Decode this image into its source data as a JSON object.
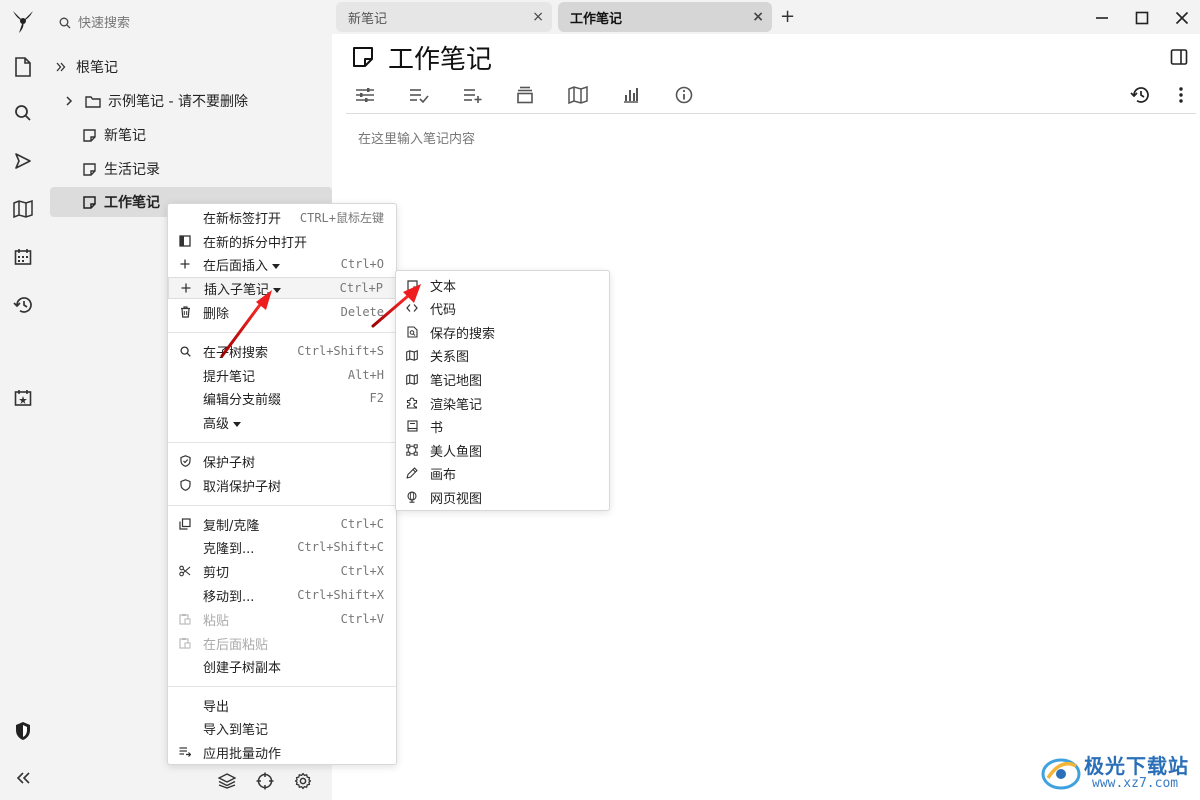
{
  "launcher": {
    "items": [
      "app-logo",
      "new-note",
      "search",
      "jump-to",
      "note-map",
      "calendar",
      "recent-changes",
      "day-note",
      "protected-session",
      "collapse"
    ]
  },
  "search": {
    "placeholder": "快速搜索"
  },
  "tree": {
    "root": "根笔记",
    "items": [
      {
        "label": "示例笔记 - 请不要删除",
        "type": "folder"
      },
      {
        "label": "新笔记",
        "type": "note"
      },
      {
        "label": "生活记录",
        "type": "note"
      },
      {
        "label": "工作笔记",
        "type": "note",
        "active": true
      }
    ]
  },
  "tabs": [
    {
      "label": "新笔记",
      "active": false
    },
    {
      "label": "工作笔记",
      "active": true
    }
  ],
  "tab_close": "×",
  "new_tab": "+",
  "note": {
    "title": "工作笔记",
    "placeholder": "在这里输入笔记内容"
  },
  "context_menu": {
    "items": [
      {
        "label": "在新标签打开",
        "key": "CTRL+鼠标左键",
        "icon": ""
      },
      {
        "label": "在新的拆分中打开",
        "key": "",
        "icon": "split-icon"
      },
      {
        "label": "在后面插入",
        "key": "Ctrl+O",
        "icon": "plus-icon",
        "caret": true
      },
      {
        "label": "插入子笔记",
        "key": "Ctrl+P",
        "icon": "plus-icon",
        "caret": true,
        "highlight": true
      },
      {
        "label": "删除",
        "key": "Delete",
        "icon": "trash-icon"
      },
      {
        "label": "在子树搜索",
        "key": "Ctrl+Shift+S",
        "icon": "search-icon"
      },
      {
        "label": "提升笔记",
        "key": "Alt+H",
        "icon": ""
      },
      {
        "label": "编辑分支前缀",
        "key": "F2",
        "icon": ""
      },
      {
        "label": "高级",
        "key": "",
        "icon": "",
        "caret": true
      },
      {
        "label": "保护子树",
        "key": "",
        "icon": "shield-check-icon"
      },
      {
        "label": "取消保护子树",
        "key": "",
        "icon": "shield-icon"
      },
      {
        "label": "复制/克隆",
        "key": "Ctrl+C",
        "icon": "copy-icon"
      },
      {
        "label": "克隆到...",
        "key": "Ctrl+Shift+C",
        "icon": ""
      },
      {
        "label": "剪切",
        "key": "Ctrl+X",
        "icon": "scissors-icon"
      },
      {
        "label": "移动到...",
        "key": "Ctrl+Shift+X",
        "icon": ""
      },
      {
        "label": "粘贴",
        "key": "Ctrl+V",
        "icon": "paste-icon",
        "disabled": true
      },
      {
        "label": "在后面粘贴",
        "key": "",
        "icon": "paste-icon",
        "disabled": true
      },
      {
        "label": "创建子树副本",
        "key": "",
        "icon": ""
      },
      {
        "label": "导出",
        "key": "",
        "icon": ""
      },
      {
        "label": "导入到笔记",
        "key": "",
        "icon": ""
      },
      {
        "label": "应用批量动作",
        "key": "",
        "icon": "list-check-icon"
      }
    ]
  },
  "sub_menu": {
    "items": [
      {
        "label": "文本",
        "icon": "note-icon"
      },
      {
        "label": "代码",
        "icon": "code-icon"
      },
      {
        "label": "保存的搜索",
        "icon": "file-search-icon"
      },
      {
        "label": "关系图",
        "icon": "map-icon"
      },
      {
        "label": "笔记地图",
        "icon": "map-icon"
      },
      {
        "label": "渲染笔记",
        "icon": "extension-icon"
      },
      {
        "label": "书",
        "icon": "book-icon"
      },
      {
        "label": "美人鱼图",
        "icon": "diagram-icon"
      },
      {
        "label": "画布",
        "icon": "pen-icon"
      },
      {
        "label": "网页视图",
        "icon": "globe-icon"
      }
    ]
  },
  "watermark": {
    "title": "极光下载站",
    "url": "www.xz7.com"
  }
}
